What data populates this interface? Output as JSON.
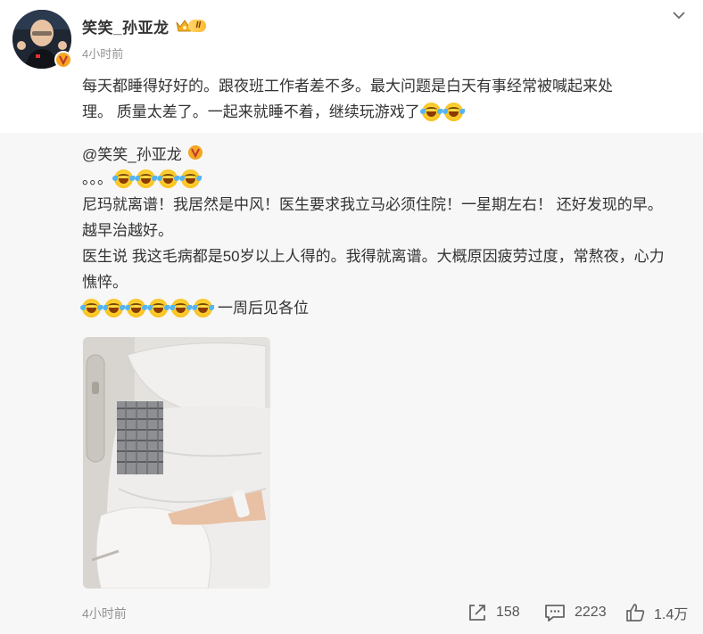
{
  "post": {
    "author": "笑笑_孙亚龙",
    "vip_level": "II",
    "time": "4小时前",
    "text_line1": "每天都睡得好好的。跟夜班工作者差不多。最大问题是白天有事经常被喊起来处",
    "text_line2": "理。 质量太差了。一起来就睡不着，继续玩游戏了",
    "text_emojis": [
      "泪笑-emoji",
      "泪笑-emoji"
    ]
  },
  "repost": {
    "author": "@笑笑_孙亚龙",
    "line1": "。。。",
    "line2": "尼玛就离谱！我居然是中风！医生要求我立马必须住院！一星期左右！ 还好发现的早。",
    "line3": "越早治越好。",
    "line4": "医生说 我这毛病都是50岁以上人得的。我得就离谱。大概原因疲劳过度，常熬夜，心力",
    "line5": "憔悴。",
    "line6": "一周后见各位"
  },
  "footer": {
    "time": "4小时前",
    "repost_count": "158",
    "comment_count": "2223",
    "like_count": "1.4万"
  },
  "colors": {
    "text": "#333333",
    "muted": "#939393",
    "repost_bg": "#f7f7f7",
    "verified": "#f5a623"
  },
  "icons": [
    "more-chevron-icon",
    "verified-icon",
    "vip-crown-icon",
    "repost-icon",
    "comment-icon",
    "like-icon",
    "laugh-cry-emoji"
  ]
}
